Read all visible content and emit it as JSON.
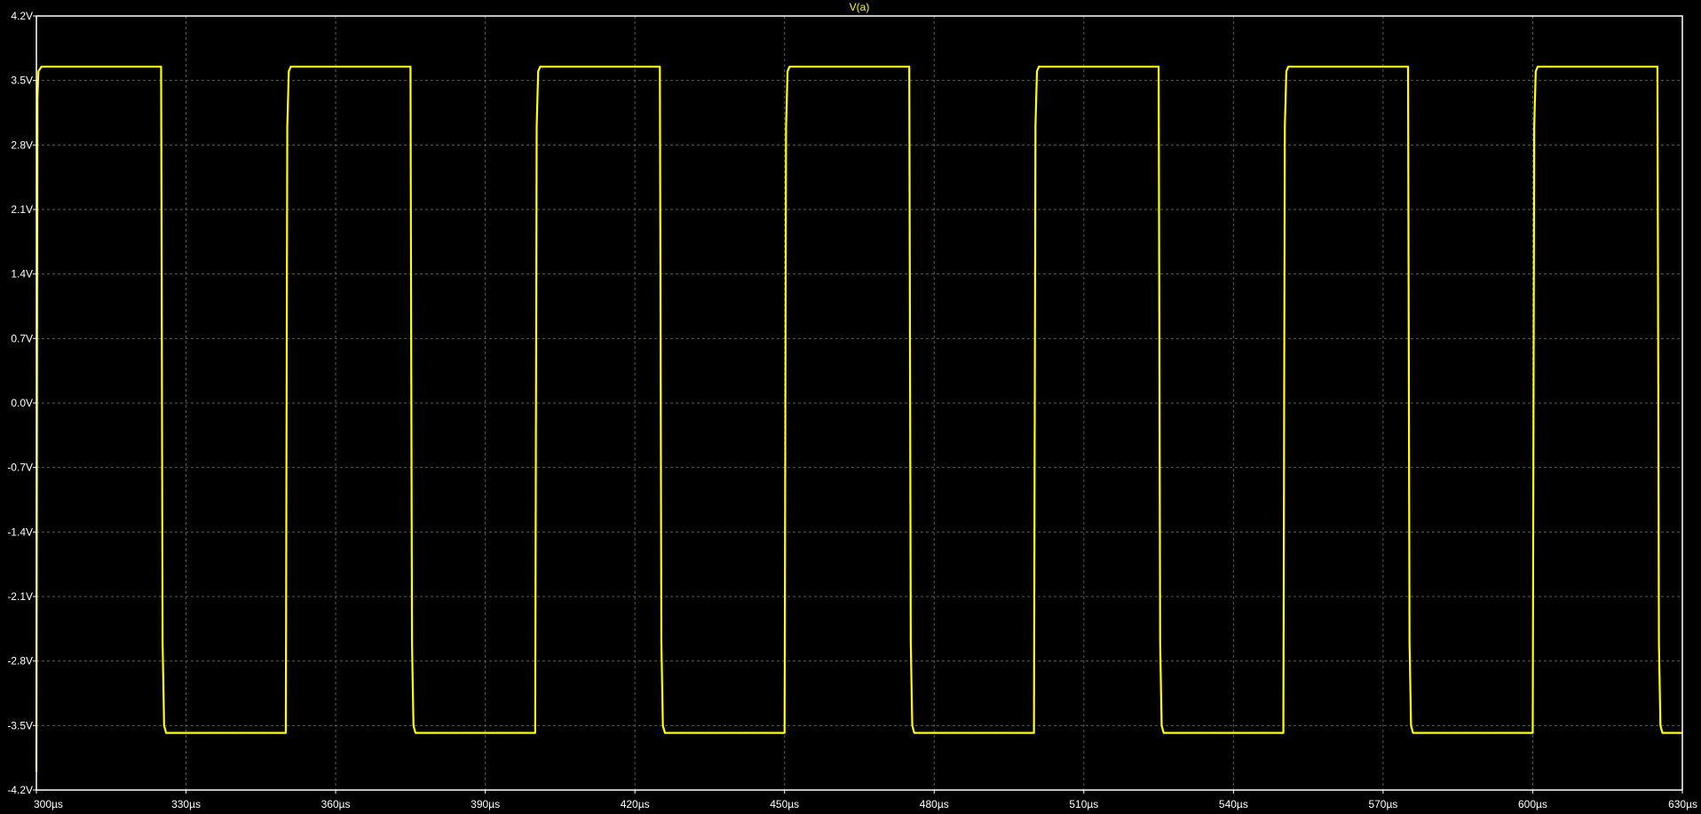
{
  "chart_data": {
    "type": "line",
    "title": "V(a)",
    "xlabel": "",
    "ylabel": "",
    "xlim": [
      300,
      630
    ],
    "ylim": [
      -4.2,
      4.2
    ],
    "x_ticks": [
      300,
      330,
      360,
      390,
      420,
      450,
      480,
      510,
      540,
      570,
      600,
      630
    ],
    "x_tick_labels": [
      "300µs",
      "330µs",
      "360µs",
      "390µs",
      "420µs",
      "450µs",
      "480µs",
      "510µs",
      "540µs",
      "570µs",
      "600µs",
      "630µs"
    ],
    "y_ticks": [
      4.2,
      3.5,
      2.8,
      2.1,
      1.4,
      0.7,
      0.0,
      -0.7,
      -1.4,
      -2.1,
      -2.8,
      -3.5,
      -4.2
    ],
    "y_tick_labels": [
      "4.2V",
      "3.5V",
      "2.8V",
      "2.1V",
      "1.4V",
      "0.7V",
      "0.0V",
      "-0.7V",
      "-1.4V",
      "-2.1V",
      "-2.8V",
      "-3.5V",
      "-4.2V"
    ],
    "grid": true,
    "colors": {
      "background": "#000000",
      "frame": "#ffffff",
      "grid": "#5a5a5a",
      "tick_text": "#ffffff"
    },
    "series": [
      {
        "name": "V(a)",
        "color": "#ffff00",
        "x": [
          300,
          300.2,
          300.4,
          301,
          325,
          325.3,
          325.6,
          326,
          350,
          350.3,
          350.6,
          351,
          375,
          375.3,
          375.6,
          376,
          400,
          400.3,
          400.6,
          401,
          425,
          425.3,
          425.6,
          426,
          450,
          450.3,
          450.6,
          451,
          475,
          475.3,
          475.6,
          476,
          500,
          500.3,
          500.6,
          501,
          525,
          525.3,
          525.6,
          526,
          550,
          550.3,
          550.6,
          551,
          575,
          575.3,
          575.6,
          576,
          600,
          600.3,
          600.6,
          601,
          625,
          625.3,
          625.6,
          626,
          630
        ],
        "y": [
          -4.0,
          3.3,
          3.6,
          3.65,
          3.65,
          -2.6,
          -3.5,
          -3.58,
          -3.58,
          3.0,
          3.6,
          3.65,
          3.65,
          -2.6,
          -3.5,
          -3.58,
          -3.58,
          3.0,
          3.6,
          3.65,
          3.65,
          -2.6,
          -3.5,
          -3.58,
          -3.58,
          3.0,
          3.6,
          3.65,
          3.65,
          -2.6,
          -3.5,
          -3.58,
          -3.58,
          3.0,
          3.6,
          3.65,
          3.65,
          -2.6,
          -3.5,
          -3.58,
          -3.58,
          3.0,
          3.6,
          3.65,
          3.65,
          -2.6,
          -3.5,
          -3.58,
          -3.58,
          3.0,
          3.6,
          3.65,
          3.65,
          -2.6,
          -3.5,
          -3.58,
          -3.58
        ]
      }
    ]
  }
}
